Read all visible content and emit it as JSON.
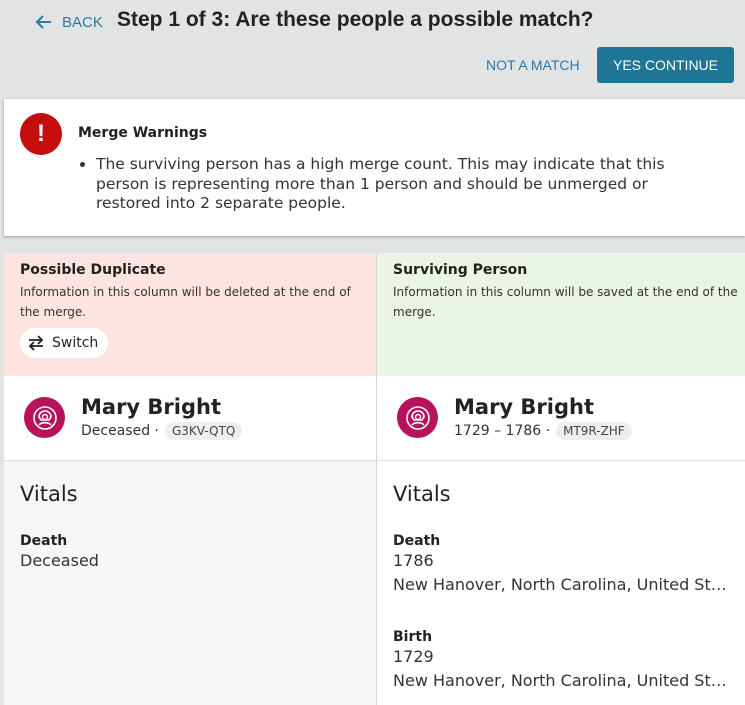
{
  "header": {
    "back_label": "BACK",
    "title": "Step 1 of 3: Are these people a possible match?",
    "not_match_label": "NOT A MATCH",
    "yes_label": "YES CONTINUE"
  },
  "warning": {
    "icon_text": "!",
    "title": "Merge Warnings",
    "items": [
      "The surviving person has a high merge count. This may indicate that this person is representing more than 1 person and should be unmerged or restored into 2 separate people."
    ]
  },
  "left": {
    "heading": "Possible Duplicate",
    "description": "Information in this column will be deleted at the end of the merge.",
    "switch_label": "Switch",
    "name": "Mary Bright",
    "lifespan": "Deceased ·",
    "pid": "G3KV-QTQ",
    "vitals_title": "Vitals",
    "death_label": "Death",
    "death_value": "Deceased"
  },
  "right": {
    "heading": "Surviving Person",
    "description": "Information in this column will be saved at the end of the merge.",
    "name": "Mary Bright",
    "lifespan": "1729 – 1786 ·",
    "pid": "MT9R-ZHF",
    "vitals_title": "Vitals",
    "death_label": "Death",
    "death_date": "1786",
    "death_place": "New Hanover, North Carolina, United States",
    "birth_label": "Birth",
    "birth_date": "1729",
    "birth_place": "New Hanover, North Carolina, United States"
  },
  "colors": {
    "accent": "#1e7596",
    "link": "#2b7aa5",
    "danger": "#c40d0d",
    "avatar": "#b8125b",
    "duplicate_bg": "#fde4e3",
    "surviving_bg": "#eaf5e7"
  }
}
